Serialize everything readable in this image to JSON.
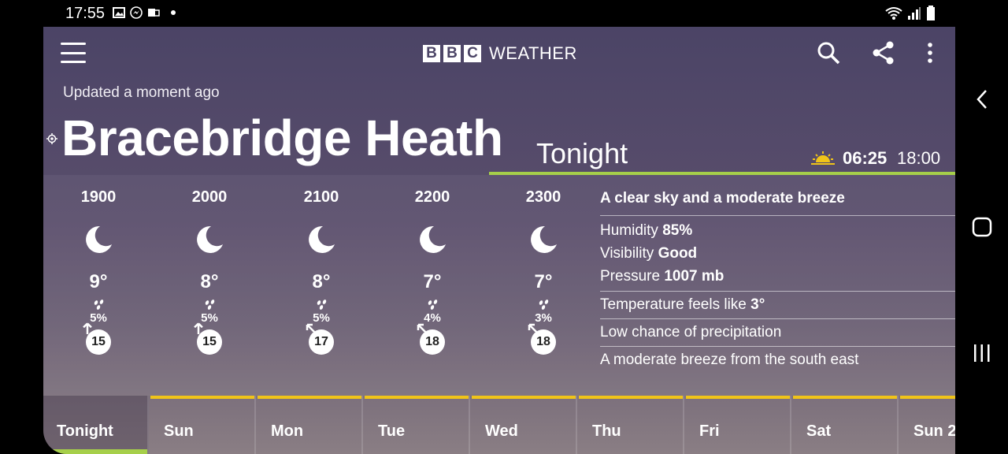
{
  "status_bar": {
    "time": "17:55"
  },
  "app": {
    "logo_letters": [
      "B",
      "B",
      "C"
    ],
    "logo_word": "WEATHER",
    "updated": "Updated a moment ago",
    "location": "Bracebridge Heath",
    "period": "Tonight",
    "sunrise": "06:25",
    "sunset": "18:00",
    "hours": [
      {
        "time": "1900",
        "temp": "9°",
        "precip": "5%",
        "wind": "15"
      },
      {
        "time": "2000",
        "temp": "8°",
        "precip": "5%",
        "wind": "15"
      },
      {
        "time": "2100",
        "temp": "8°",
        "precip": "5%",
        "wind": "17"
      },
      {
        "time": "2200",
        "temp": "7°",
        "precip": "4%",
        "wind": "18"
      },
      {
        "time": "2300",
        "temp": "7°",
        "precip": "3%",
        "wind": "18"
      }
    ],
    "details": {
      "summary": "A clear sky and a moderate breeze",
      "humidity_label": "Humidity",
      "humidity_value": "85%",
      "visibility_label": "Visibility",
      "visibility_value": "Good",
      "pressure_label": "Pressure",
      "pressure_value": "1007 mb",
      "feels_like_label": "Temperature feels like",
      "feels_like_value": "3°",
      "precipitation": "Low chance of precipitation",
      "wind": "A moderate breeze from the south east"
    },
    "days": [
      "Tonight",
      "Sun",
      "Mon",
      "Tue",
      "Wed",
      "Thu",
      "Fri",
      "Sat",
      "Sun 2"
    ],
    "colors": {
      "accent_green": "#a6cf4a",
      "accent_yellow": "#f0c419"
    }
  }
}
